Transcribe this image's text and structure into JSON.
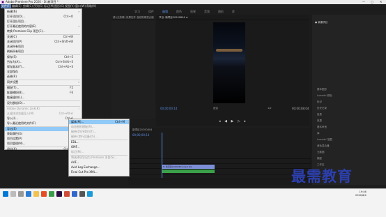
{
  "window": {
    "title": "Adobe Premiere Pro 2020 - D:\\新项目 *",
    "minimize": "—",
    "maximize": "□",
    "close": "✕"
  },
  "menubar": [
    "文件(F)",
    "编辑(E)",
    "剪辑(C)",
    "序列(S)",
    "标记(M)",
    "图形(G)",
    "视图(V)",
    "窗口(W)",
    "帮助(H)"
  ],
  "workspaces": [
    "学习",
    "组件",
    "编辑",
    "颜色",
    "效果",
    "音频",
    "图形",
    "库"
  ],
  "source_panel": {
    "tabs": "源:(无剪辑)  效果控件  音频剪辑混合器"
  },
  "program_panel": {
    "title": "节目: 新项目20200804 ≡",
    "timecode_left": "00;00;00;14",
    "fit": "适合",
    "timecode_right": "00;00;08;04",
    "quality": "1/2"
  },
  "right_panel": {
    "items": [
      "基本图形",
      "Lumetri 颜色",
      "标记",
      "历史记录",
      "信息",
      "效果",
      "基本声音",
      "库",
      "Lumetri 范围",
      "音轨混合器",
      "元数据",
      "捕捉",
      "工作区",
      "项目",
      "媒体浏览器"
    ],
    "highlight": "● 新建项目"
  },
  "file_menu": {
    "items": [
      {
        "label": "新建(N)",
        "shortcut": "",
        "dis": false,
        "arrow": true
      },
      {
        "label": "打开项目(O)...",
        "shortcut": "Ctrl+O",
        "dis": false
      },
      {
        "label": "打开团队项目...",
        "shortcut": "",
        "dis": false
      },
      {
        "label": "打开最近使用的内容(E)",
        "shortcut": "",
        "dis": false,
        "arrow": true
      },
      {
        "label": "转换 Premiere Clip 项目(C)...",
        "shortcut": "",
        "dis": false
      },
      {
        "label": "关闭(C)",
        "shortcut": "Ctrl+W",
        "dis": false
      },
      {
        "label": "关闭项目(P)",
        "shortcut": "Ctrl+Shift+W",
        "dis": false
      },
      {
        "label": "关闭所有项目",
        "shortcut": "",
        "dis": false
      },
      {
        "label": "刷新所有项目",
        "shortcut": "",
        "dis": false
      },
      {
        "label": "保存(S)",
        "shortcut": "Ctrl+S",
        "dis": false
      },
      {
        "label": "另存为(A)...",
        "shortcut": "Ctrl+Shift+S",
        "dis": false
      },
      {
        "label": "保存副本(Y)...",
        "shortcut": "Ctrl+Alt+S",
        "dis": false
      },
      {
        "label": "全部保存",
        "shortcut": "",
        "dis": false
      },
      {
        "label": "还原(R)",
        "shortcut": "",
        "dis": false
      },
      {
        "label": "同步设置",
        "shortcut": "",
        "dis": false,
        "arrow": true
      },
      {
        "label": "捕捉(T)...",
        "shortcut": "F5",
        "dis": false
      },
      {
        "label": "批量捕捉(B)...",
        "shortcut": "F6",
        "dis": false
      },
      {
        "label": "链接媒体(L)...",
        "shortcut": "",
        "dis": false
      },
      {
        "label": "设为脱机(O)...",
        "shortcut": "",
        "dis": false
      },
      {
        "label": "Adobe Dynamic Link(K)",
        "shortcut": "",
        "dis": true,
        "arrow": true
      },
      {
        "label": "从媒体浏览器导入(M)",
        "shortcut": "Ctrl+Alt+I",
        "dis": true
      },
      {
        "label": "导入(I)...",
        "shortcut": "Ctrl+I",
        "dis": false
      },
      {
        "label": "导入最近使用的文件(F)",
        "shortcut": "",
        "dis": false,
        "arrow": true
      },
      {
        "label": "导出(E)",
        "shortcut": "",
        "dis": false,
        "arrow": true,
        "hl": true
      },
      {
        "label": "获取属性(G)",
        "shortcut": "",
        "dis": false,
        "arrow": true
      },
      {
        "label": "项目设置(P)",
        "shortcut": "",
        "dis": false,
        "arrow": true
      },
      {
        "label": "项目管理(M)...",
        "shortcut": "",
        "dis": false
      },
      {
        "label": "退出(X)",
        "shortcut": "Ctrl+Q",
        "dis": false
      }
    ]
  },
  "export_menu": {
    "items": [
      {
        "label": "媒体(M)...",
        "shortcut": "Ctrl+M",
        "hl": true
      },
      {
        "label": "动态图形模板(R)...",
        "dis": true
      },
      {
        "label": "磁带(DV/HDV)(T)...",
        "dis": true
      },
      {
        "label": "磁带 (串行设备)(S)...",
        "dis": true
      },
      {
        "label": "EDL..."
      },
      {
        "label": "OMF..."
      },
      {
        "label": "标记(M)...",
        "dis": true
      },
      {
        "label": "将选择项导出为 Premiere 项目(S)...",
        "dis": true
      },
      {
        "label": "AAF..."
      },
      {
        "label": "Avid Log Exchange..."
      },
      {
        "label": "Final Cut Pro XML..."
      }
    ]
  },
  "timeline": {
    "timecode": "00;00;00;14",
    "tab": "新项目20200804",
    "clip_label": "fx 新项目20200804.mp4 [V]"
  },
  "watermark": "最需教育",
  "clock": {
    "time": "19:46",
    "date": "2020/8/4"
  }
}
